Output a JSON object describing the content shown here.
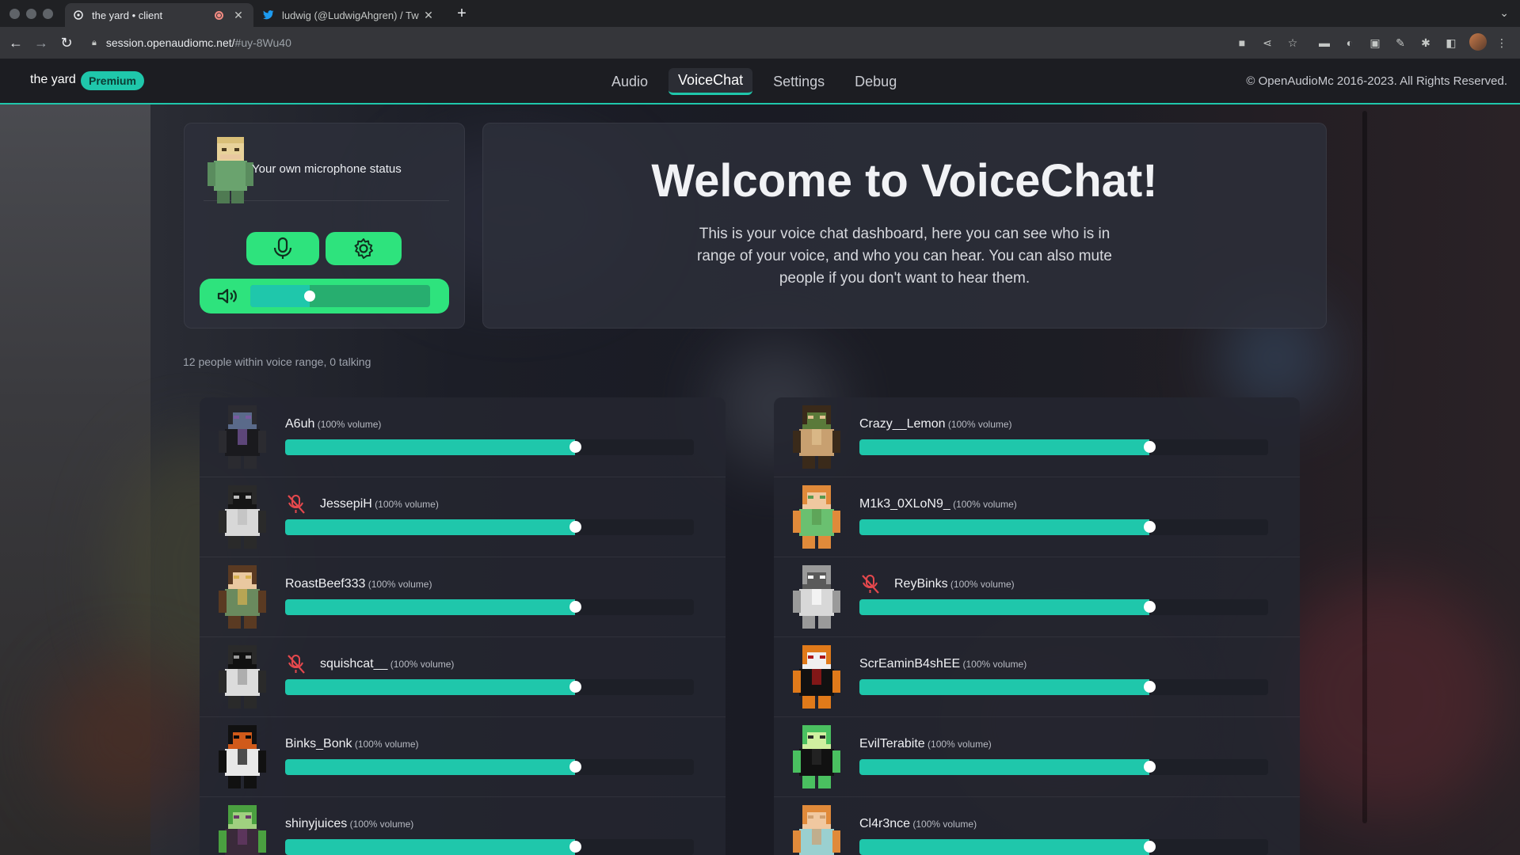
{
  "browser": {
    "tabs": [
      {
        "title": "the yard • client",
        "active": true
      },
      {
        "title": "ludwig (@LudwigAhgren) / Tw",
        "active": false
      }
    ],
    "url_host": "session.openaudiomc.net/",
    "url_hash": "#uy-8Wu40"
  },
  "app": {
    "server_name": "the yard",
    "badge": "Premium",
    "nav": [
      "Audio",
      "VoiceChat",
      "Settings",
      "Debug"
    ],
    "active_nav": "VoiceChat",
    "copyright": "© OpenAudioMc 2016-2023. All Rights Reserved."
  },
  "mic": {
    "title": "Your own microphone status",
    "volume_fraction": 0.33
  },
  "welcome": {
    "title": "Welcome to VoiceChat!",
    "text": "This is your voice chat dashboard, here you can see who is in range of your voice, and who you can hear. You can also mute people if you don't want to hear them."
  },
  "range_text": "12 people within voice range, 0 talking",
  "players_left": [
    {
      "name": "A6uh",
      "volume": "(100% volume)",
      "muted": false,
      "fill": 0.71
    },
    {
      "name": "JessepiH",
      "volume": "(100% volume)",
      "muted": true,
      "fill": 0.71
    },
    {
      "name": "RoastBeef333",
      "volume": "(100% volume)",
      "muted": false,
      "fill": 0.71
    },
    {
      "name": "squishcat__",
      "volume": "(100% volume)",
      "muted": true,
      "fill": 0.71
    },
    {
      "name": "Binks_Bonk",
      "volume": "(100% volume)",
      "muted": false,
      "fill": 0.71
    },
    {
      "name": "shinyjuices",
      "volume": "(100% volume)",
      "muted": false,
      "fill": 0.71
    }
  ],
  "players_right": [
    {
      "name": "Crazy__Lemon",
      "volume": "(100% volume)",
      "muted": false,
      "fill": 0.71
    },
    {
      "name": "M1k3_0XLoN9_",
      "volume": "(100% volume)",
      "muted": false,
      "fill": 0.71
    },
    {
      "name": "ReyBinks",
      "volume": "(100% volume)",
      "muted": true,
      "fill": 0.71
    },
    {
      "name": "ScrEaminB4shEE",
      "volume": "(100% volume)",
      "muted": false,
      "fill": 0.71
    },
    {
      "name": "EvilTerabite",
      "volume": "(100% volume)",
      "muted": false,
      "fill": 0.71
    },
    {
      "name": "Cl4r3nce",
      "volume": "(100% volume)",
      "muted": false,
      "fill": 0.71
    }
  ],
  "colors": {
    "accent": "#1fc7ab",
    "green_button": "#2ee37d",
    "muted_red": "#e5484d"
  },
  "icons": {
    "mic_button": "microphone-icon",
    "settings_button": "gear-icon",
    "volume": "speaker-icon",
    "muted": "microphone-off-icon"
  }
}
